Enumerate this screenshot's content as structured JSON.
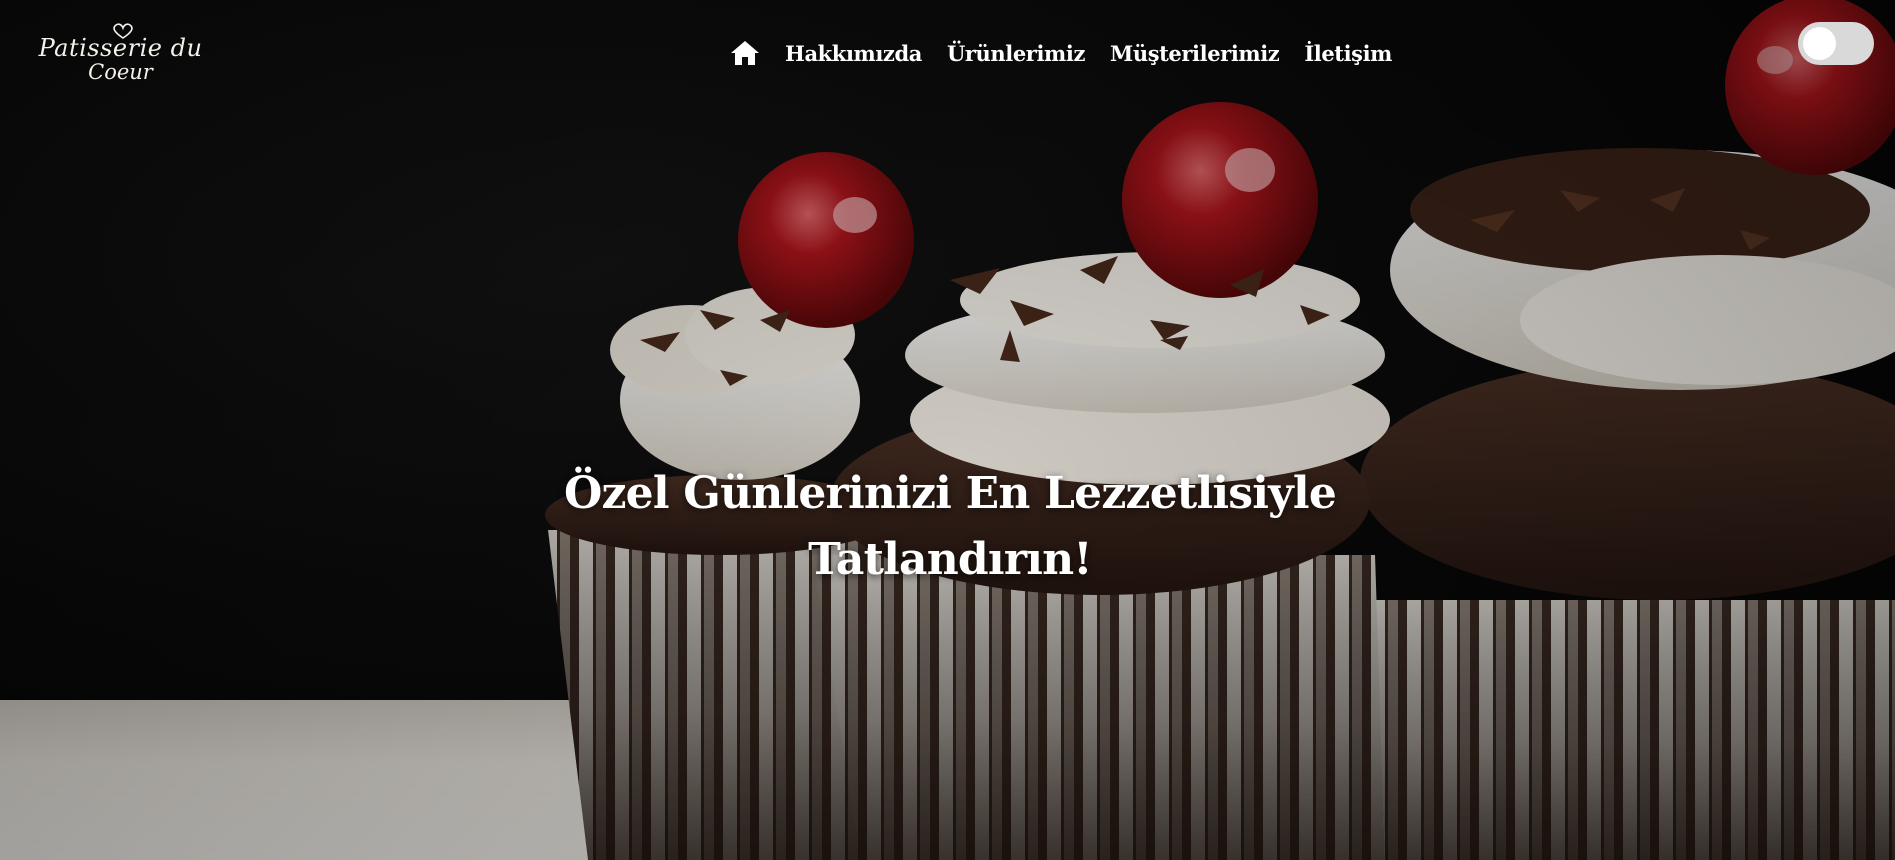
{
  "brand": {
    "logo_line1": "Patisserie du",
    "logo_line2": "Coeur"
  },
  "nav": {
    "home_icon": "home-icon",
    "items": [
      {
        "label": "Hakkımızda"
      },
      {
        "label": "Ürünlerimiz"
      },
      {
        "label": "Müşterilerimiz"
      },
      {
        "label": "İletişim"
      }
    ]
  },
  "theme_toggle": {
    "state": "off"
  },
  "hero": {
    "headline": "Özel Günlerinizi En Lezzetlisiyle Tatlandırın!",
    "background": "cupcakes-photo"
  },
  "colors": {
    "background": "#0a0a0a",
    "text": "#ffffff",
    "toggle_track": "#d9d9d9",
    "cherry": "#b2151c",
    "cream": "#f3efe6",
    "chocolate": "#3a2419"
  }
}
